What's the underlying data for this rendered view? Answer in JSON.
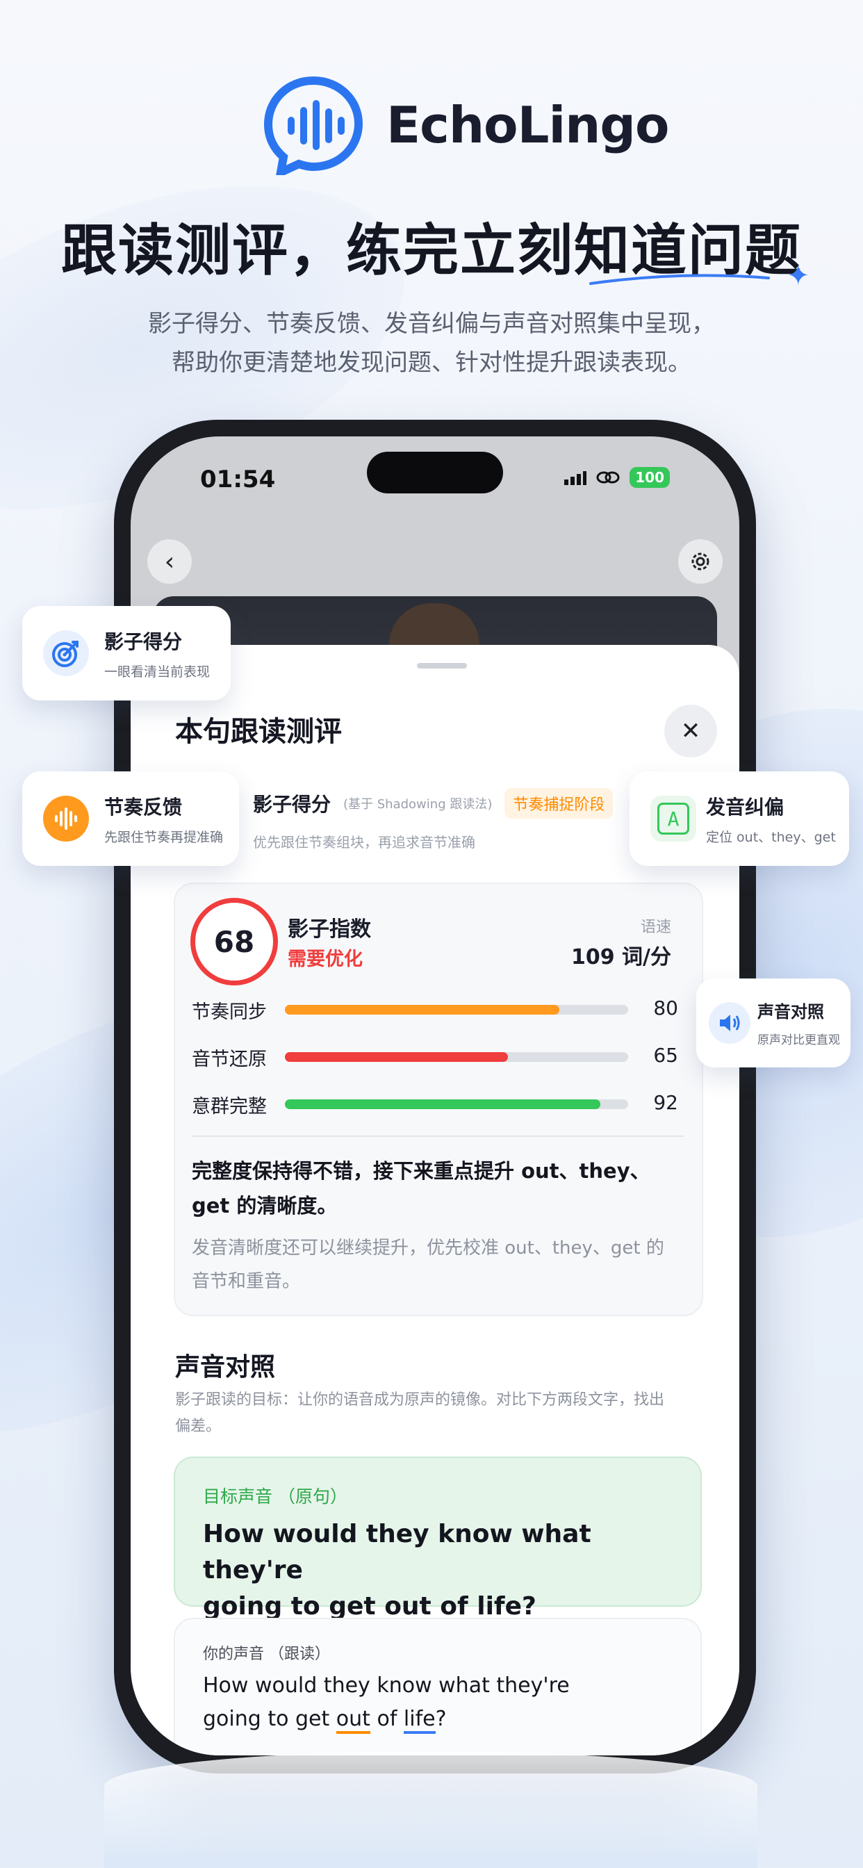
{
  "brand": {
    "name": "EchoLingo"
  },
  "headline": {
    "title": "跟读测评，练完立刻知道问题",
    "sub1": "影子得分、节奏反馈、发音纠偏与声音对照集中呈现，",
    "sub2": "帮助你更清楚地发现问题、针对性提升跟读表现。"
  },
  "status": {
    "time": "01:54",
    "battery": "100"
  },
  "nav": {
    "back": "‹"
  },
  "sheet": {
    "title": "本句跟读测评",
    "close": "✕",
    "score_label": "影子得分",
    "score_basis": "(基于 Shadowing 跟读法)",
    "score_tag": "节奏捕捉阶段",
    "score_hint": "优先跟住节奏组块，再追求音节准确"
  },
  "metric": {
    "score": "68",
    "index_label": "影子指数",
    "index_status": "需要优化",
    "speed_label": "语速",
    "speed_value": "109 词/分",
    "bars": [
      {
        "label": "节奏同步",
        "value": 80,
        "display": "80",
        "color": "#ff9a1f"
      },
      {
        "label": "音节还原",
        "value": 65,
        "display": "65",
        "color": "#f03d3d"
      },
      {
        "label": "意群完整",
        "value": 92,
        "display": "92",
        "color": "#34c759"
      }
    ],
    "summary": "完整度保持得不错，接下来重点提升 out、they、get 的清晰度。",
    "note": "发音清晰度还可以继续提升，优先校准 out、they、get 的音节和重音。"
  },
  "compare": {
    "title": "声音对照",
    "desc": "影子跟读的目标：让你的语音成为原声的镜像。对比下方两段文字，找出偏差。",
    "target_label": "目标声音 （原句）",
    "target_a": "How would they know what they're",
    "target_b": "going to get ",
    "target_out": "out",
    "target_c": " of life?",
    "mine_label": "你的声音 （跟读）",
    "mine_a": "How would they know what they're",
    "mine_b": "going to get ",
    "mine_out": "out",
    "mine_of": " of ",
    "mine_life": "life",
    "mine_end": "?"
  },
  "chips": {
    "shadow": {
      "title": "影子得分",
      "desc": "一眼看清当前表现"
    },
    "rhythm": {
      "title": "节奏反馈",
      "desc": "先跟住节奏再提准确"
    },
    "pron": {
      "title": "发音纠偏",
      "desc": "定位 out、they、get",
      "icon_letter": "A"
    },
    "voice": {
      "title": "声音对照",
      "desc": "原声对比更直观"
    }
  },
  "colors": {
    "accent": "#3a7bf5",
    "orange": "#ff8a00",
    "red": "#f03d3d",
    "green": "#34c759"
  },
  "icons": [
    "logo-chat-wave-icon",
    "target-icon",
    "waveform-icon",
    "letter-a-icon",
    "speaker-icon",
    "back-chevron-icon",
    "gear-icon",
    "close-icon"
  ]
}
